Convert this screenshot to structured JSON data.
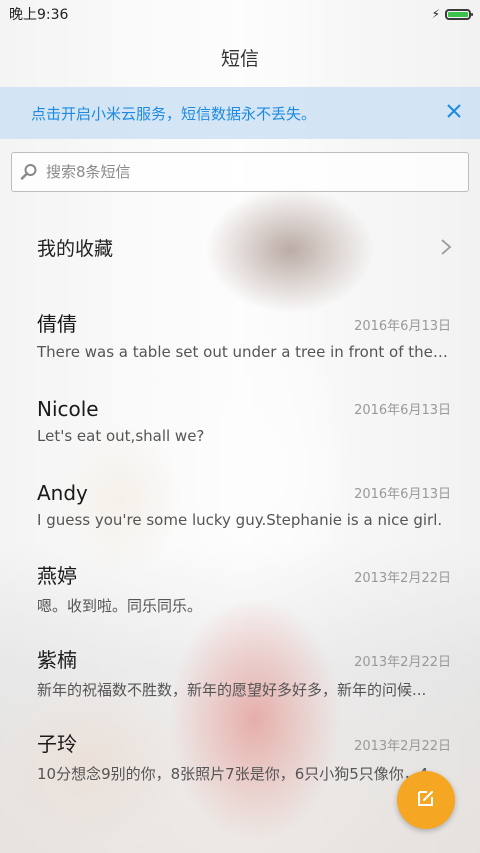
{
  "status_bar": {
    "time": "晚上9:36",
    "battery_level": 1.0,
    "battery_color": "#3bc24a",
    "charging_icon": "bolt-icon"
  },
  "header": {
    "title": "短信"
  },
  "banner": {
    "text": "点击开启小米云服务，短信数据永不丢失。",
    "close_icon": "close-icon",
    "color": "#1d8ae0"
  },
  "search": {
    "placeholder": "搜索8条短信",
    "value": "",
    "icon": "search-icon"
  },
  "favorites": {
    "label": "我的收藏",
    "icon": "chevron-right-icon"
  },
  "threads": [
    {
      "name": "倩倩",
      "date": "2016年6月13日",
      "snippet": "There was a table set out under a tree in front of the ho..."
    },
    {
      "name": "Nicole",
      "date": "2016年6月13日",
      "snippet": "Let's eat out,shall we?"
    },
    {
      "name": "Andy",
      "date": "2016年6月13日",
      "snippet": "I guess you're some lucky guy.Stephanie is a nice girl."
    },
    {
      "name": "燕婷",
      "date": "2013年2月22日",
      "snippet": "嗯。收到啦。同乐同乐。"
    },
    {
      "name": "紫楠",
      "date": "2013年2月22日",
      "snippet": "新年的祝福数不胜数，新年的愿望好多好多，新年的问候..."
    },
    {
      "name": "子玲",
      "date": "2013年2月22日",
      "snippet": "10分想念9别的你，8张照片7张是你，6只小狗5只像你，4..."
    }
  ],
  "compose_button": {
    "icon": "compose-icon",
    "color": "#f5a623"
  }
}
